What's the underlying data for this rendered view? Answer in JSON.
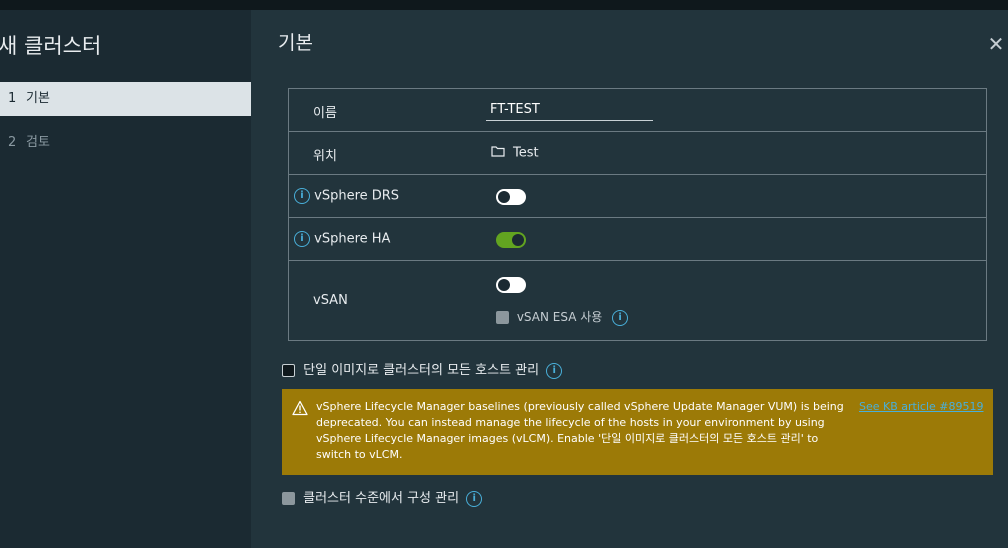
{
  "wizard": {
    "title": "새 클러스터",
    "steps": [
      {
        "number": "1",
        "label": "기본",
        "state": "active"
      },
      {
        "number": "2",
        "label": "검토",
        "state": "inactive"
      }
    ]
  },
  "page": {
    "title": "기본",
    "close_icon": "close-icon"
  },
  "form": {
    "name_label": "이름",
    "name_value": "FT-TEST",
    "location_label": "위치",
    "location_value": "Test",
    "drs_label": "vSphere DRS",
    "drs_enabled": false,
    "ha_label": "vSphere HA",
    "ha_enabled": true,
    "vsan_label": "vSAN",
    "vsan_enabled": false,
    "vsan_esa_label": "vSAN ESA 사용",
    "vsan_esa_checked": false
  },
  "single_image": {
    "label": "단일 이미지로 클러스터의 모든 호스트 관리",
    "checked": false
  },
  "alert": {
    "text": "vSphere Lifecycle Manager baselines (previously called vSphere Update Manager VUM) is being deprecated. You can instead manage the lifecycle of the hosts in your environment by using vSphere Lifecycle Manager images (vLCM). Enable '단일 이미지로 클러스터의 모든 호스트 관리' to switch to vLCM.",
    "link": "See KB article #89519",
    "color": "#9c7a07"
  },
  "cluster_config": {
    "label": "클러스터 수준에서 구성 관리",
    "checked": false
  },
  "colors": {
    "accent_info": "#49afd9",
    "toggle_on": "#62a420",
    "panel_bg": "#22343c",
    "sidebar_bg": "#1b2a32"
  }
}
